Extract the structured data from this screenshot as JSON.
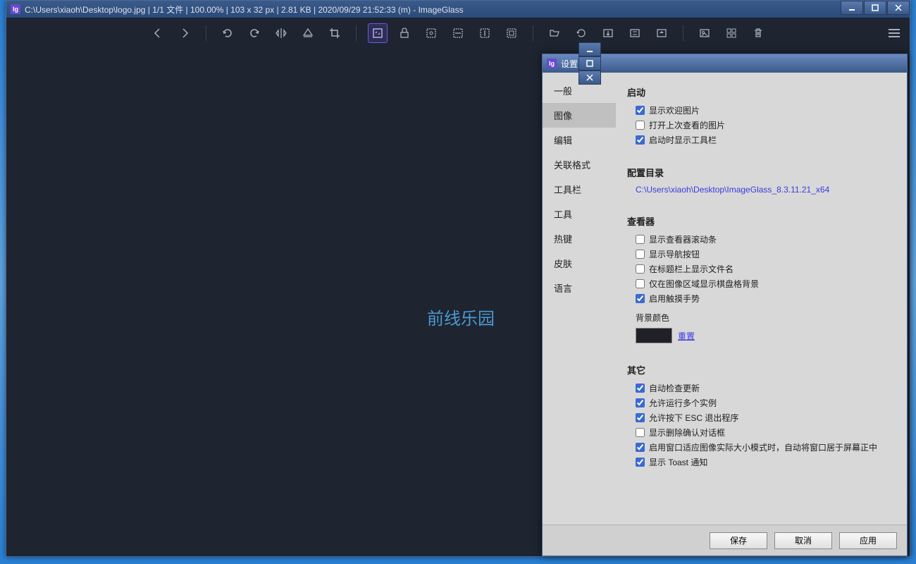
{
  "main": {
    "title": "C:\\Users\\xiaoh\\Desktop\\logo.jpg  |  1/1 文件  |  100.00%  |  103 x 32 px  |  2.81 KB  |  2020/09/29 21:52:33 (m)  - ImageGlass",
    "canvasText": "前线乐园"
  },
  "toolbarIcons": {
    "prev": "prev",
    "next": "next",
    "rotateLeft": "rotate-left",
    "rotateRight": "rotate-right",
    "flipH": "flip-h",
    "flipV": "flip-v",
    "crop": "crop",
    "actualSize": "actual-size",
    "lock": "lock",
    "autoZoom": "auto-zoom",
    "scaleW": "scale-w",
    "scaleH": "scale-h",
    "fitWindow": "fit-window",
    "openFile": "open-file",
    "refresh": "refresh",
    "goto": "goto",
    "fullscreen": "fullscreen",
    "slideshow": "slideshow",
    "thumbnail": "thumbnail",
    "checkerboard": "checkerboard",
    "delete": "delete",
    "menu": "menu"
  },
  "settings": {
    "title": "设置",
    "sidebar": [
      "一般",
      "图像",
      "编辑",
      "关联格式",
      "工具栏",
      "工具",
      "热键",
      "皮肤",
      "语言"
    ],
    "sections": {
      "startup": {
        "title": "启动",
        "items": [
          {
            "label": "显示欢迎图片",
            "checked": true
          },
          {
            "label": "打开上次查看的图片",
            "checked": false
          },
          {
            "label": "启动时显示工具栏",
            "checked": true
          }
        ]
      },
      "configDir": {
        "title": "配置目录",
        "path": "C:\\Users\\xiaoh\\Desktop\\ImageGlass_8.3.11.21_x64"
      },
      "viewer": {
        "title": "查看器",
        "items": [
          {
            "label": "显示查看器滚动条",
            "checked": false
          },
          {
            "label": "显示导航按钮",
            "checked": false
          },
          {
            "label": "在标题栏上显示文件名",
            "checked": false
          },
          {
            "label": "仅在图像区域显示棋盘格背景",
            "checked": false
          },
          {
            "label": "启用触摸手势",
            "checked": true
          }
        ],
        "bgColorLabel": "背景颜色",
        "resetLabel": "重置"
      },
      "other": {
        "title": "其它",
        "items": [
          {
            "label": "自动检查更新",
            "checked": true
          },
          {
            "label": "允许运行多个实例",
            "checked": true
          },
          {
            "label": "允许按下 ESC 退出程序",
            "checked": true
          },
          {
            "label": "显示删除确认对话框",
            "checked": false
          },
          {
            "label": "启用窗口适应图像实际大小模式时，自动将窗口居于屏幕正中",
            "checked": true
          },
          {
            "label": "显示 Toast 通知",
            "checked": true
          }
        ]
      }
    },
    "footer": {
      "save": "保存",
      "cancel": "取消",
      "apply": "应用"
    }
  }
}
